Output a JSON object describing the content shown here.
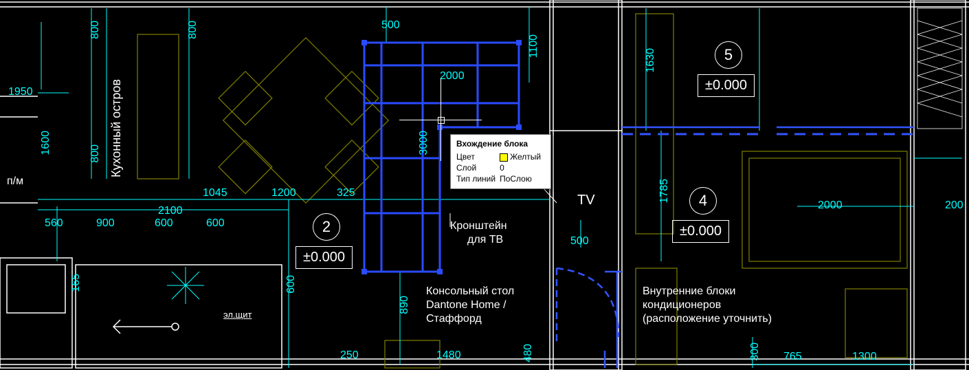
{
  "tooltip": {
    "title": "Вхождение блока",
    "rows": [
      {
        "k": "Цвет",
        "v": "Желтый",
        "swatch": true
      },
      {
        "k": "Слой",
        "v": "0"
      },
      {
        "k": "Тип линий",
        "v": "ПоСлою"
      }
    ]
  },
  "markers": {
    "m2": "2",
    "m4": "4",
    "m5": "5"
  },
  "elevations": {
    "e2": "±0.000",
    "e4": "±0.000",
    "e5": "±0.000"
  },
  "labels": {
    "kitchen_island": "Кухонный остров",
    "pm": "п/м",
    "tv": "TV",
    "bracket_l1": "Кронштейн",
    "bracket_l2": "для ТВ",
    "console_l1": "Консольный стол",
    "console_l2": "Dantone Home /",
    "console_l3": "Стаффорд",
    "ac_l1": "Внутренние блоки",
    "ac_l2": "кондиционеров",
    "ac_l3": "(расположение уточнить)",
    "elpanel": "эл.щит"
  },
  "dims": {
    "d1950": "1950",
    "d1600": "1600",
    "d800a": "800",
    "d800b": "800",
    "d800c": "800",
    "d560": "560",
    "d900": "900",
    "d600a": "600",
    "d600b": "600",
    "d165": "165",
    "d2100": "2100",
    "d1045": "1045",
    "d1200": "1200",
    "d325": "325",
    "d500a": "500",
    "d3000": "3000",
    "d2000a": "2000",
    "d2000b": "2000",
    "d890": "890",
    "d250": "250",
    "d1480": "1480",
    "d480": "480",
    "d500b": "500",
    "d1100": "1100",
    "d1630": "1630",
    "d1785": "1785",
    "d765": "765",
    "d1300": "1300",
    "d300": "300",
    "d200": "200",
    "d600c": "600"
  }
}
